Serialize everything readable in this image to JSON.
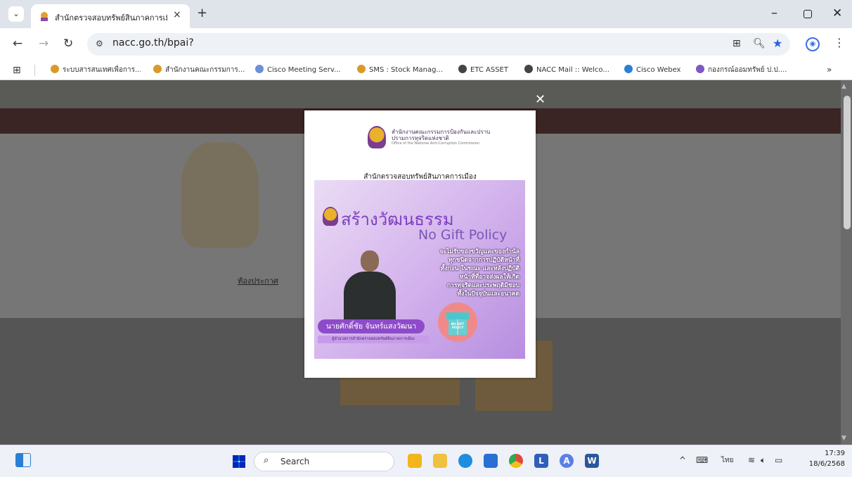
{
  "browser": {
    "tab_title": "สำนักตรวจสอบทรัพย์สินภาคการเมือง",
    "tab_close": "×",
    "new_tab": "+",
    "url": "nacc.go.th/bpai?",
    "bookmarks": [
      {
        "label": "ระบบสารสนเทศเพื่อการ...",
        "color": "#d99a2b"
      },
      {
        "label": "สำนักงานคณะกรรมการ...",
        "color": "#d99a2b"
      },
      {
        "label": "Cisco Meeting Serv...",
        "color": "#6d8fd6"
      },
      {
        "label": "SMS : Stock Manag...",
        "color": "#d99a2b"
      },
      {
        "label": "ETC ASSET",
        "color": "#444444"
      },
      {
        "label": "NACC Mail :: Welco...",
        "color": "#444444"
      },
      {
        "label": "Cisco Webex",
        "color": "#2a7fd4"
      },
      {
        "label": "กองกรณ์ออมทรัพย์ ป.ป....",
        "color": "#7e57c2"
      }
    ]
  },
  "site": {
    "link_text": "ท้องประกาศ"
  },
  "modal": {
    "office_name": "สำนักงานคณะกรรมการป้องกันและปราบปรามการทุจริตแห่งชาติ",
    "office_sub": "Office of the National Anti-Corruption Commission",
    "heading": "สำนักตรวจสอบทรัพย์สินภาคการเมือง",
    "poster": {
      "title": "สร้างวัฒนธรรม",
      "subtitle": "No Gift Policy",
      "pledge": [
        "จะไม่รับของขวัญและของกำนัล",
        "ทุกชนิดจากการปฏิบัติหน้าที่",
        "ทั้งก่อน ในขณะ และหลังปฏิบัติ",
        "หน้าที่ที่อาจส่งผลให้เกิด",
        "การทุจริตและประพฤติมิชอบ",
        "ทั้งในปัจจุบันและอนาคต"
      ],
      "name": "นายศักดิ์ชัย จันทร์แสงวัฒนา",
      "position": "ผู้อำนวยการสำนักตรวจสอบทรัพย์สินภาคการเมือง",
      "gift_text": "NO GIFT POLICY"
    }
  },
  "taskbar": {
    "search_label": "Search",
    "apps": [
      {
        "name": "file-explorer",
        "color": "#f2b51b",
        "letter": ""
      },
      {
        "name": "folder",
        "color": "#f0c040",
        "letter": ""
      },
      {
        "name": "edge",
        "color": "#1f8de0",
        "letter": ""
      },
      {
        "name": "store",
        "color": "#2a6fd4",
        "letter": ""
      },
      {
        "name": "chrome",
        "color": "#e0483a",
        "letter": ""
      },
      {
        "name": "lens",
        "color": "#2f5fb8",
        "letter": "L"
      },
      {
        "name": "app-a",
        "color": "#5b7fe8",
        "letter": "A"
      },
      {
        "name": "word",
        "color": "#2b579a",
        "letter": "W"
      }
    ],
    "language": "ไทย",
    "time": "17:39",
    "date": "18/6/2568"
  }
}
